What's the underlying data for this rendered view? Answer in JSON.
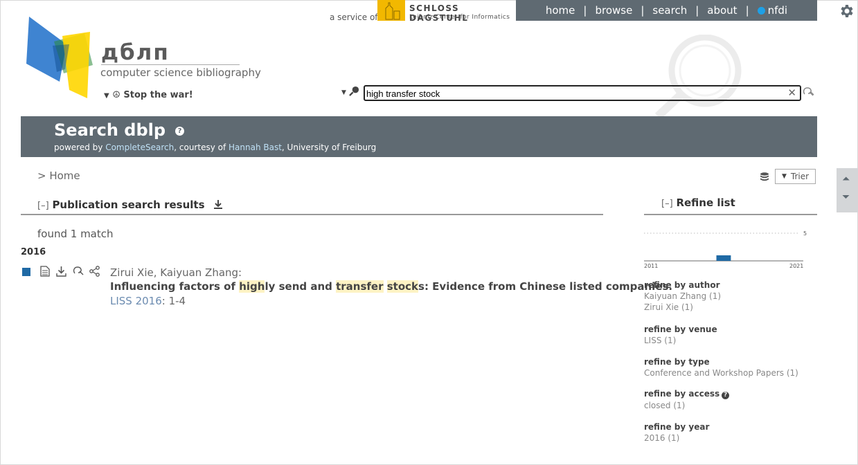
{
  "header": {
    "service_prefix": "a service of",
    "dagstuhl_line1": "SCHLOSS DAGSTUHL",
    "dagstuhl_line2": "Leibniz Center for Informatics",
    "nav": [
      "home",
      "browse",
      "search",
      "about",
      "nfdi"
    ],
    "logo_name": "дблп",
    "logo_subtitle": "computer science bibliography",
    "stop_war": "Stop the war!"
  },
  "search": {
    "value": "high transfer stock"
  },
  "banner": {
    "title": "Search dblp",
    "powered_by": "powered by",
    "engine": "CompleteSearch",
    "courtesy": ", courtesy of",
    "person": "Hannah Bast",
    "university": ", University of Freiburg"
  },
  "breadcrumb": "> Home",
  "mirror": "Trier",
  "results": {
    "toggle": "[–]",
    "heading": "Publication search results",
    "found": "found 1 match",
    "year": "2016",
    "entry": {
      "authors": "Zirui Xie, Kaiyuan Zhang:",
      "title_parts": [
        "Influencing factors of ",
        "high",
        "ly send and ",
        "transfer",
        " ",
        "stock",
        "s: Evidence from Chinese listed companies."
      ],
      "venue": "LISS 2016",
      "pages": ": 1-4"
    }
  },
  "refine": {
    "toggle": "[–]",
    "heading": "Refine list",
    "histogram": {
      "x_start": "2011",
      "x_end": "2021",
      "y_max_label": "5",
      "bar_year": 2016,
      "bar_count": 1,
      "y_max": 5
    },
    "groups": [
      {
        "label": "refine by author",
        "items": [
          "Kaiyuan Zhang (1)",
          "Zirui Xie (1)"
        ]
      },
      {
        "label": "refine by venue",
        "items": [
          "LISS (1)"
        ]
      },
      {
        "label": "refine by type",
        "items": [
          "Conference and Workshop Papers (1)"
        ]
      },
      {
        "label": "refine by access",
        "items": [
          "closed (1)"
        ]
      },
      {
        "label": "refine by year",
        "items": [
          "2016 (1)"
        ]
      }
    ]
  },
  "colors": {
    "header_gray": "#5f6a72",
    "entry_type": "#1f6aa5",
    "highlight": "#fdf3c4"
  }
}
